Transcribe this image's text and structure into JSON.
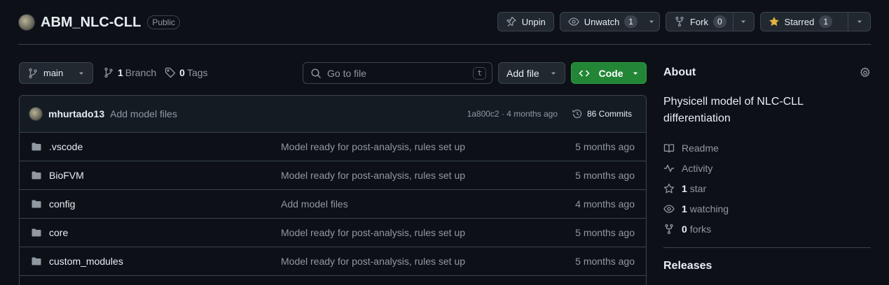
{
  "repo": {
    "name": "ABM_NLC-CLL",
    "visibility": "Public"
  },
  "actions": {
    "unpin": "Unpin",
    "unwatch": "Unwatch",
    "watch_count": "1",
    "fork": "Fork",
    "fork_count": "0",
    "starred": "Starred",
    "star_count": "1"
  },
  "toolbar": {
    "branch": "main",
    "branch_count": "1",
    "branch_label": "Branch",
    "tag_count": "0",
    "tag_label": "Tags",
    "search_placeholder": "Go to file",
    "search_shortcut": "t",
    "add_file": "Add file",
    "code": "Code"
  },
  "latest_commit": {
    "author": "mhurtado13",
    "message": "Add model files",
    "hash_time": "1a800c2 · 4 months ago",
    "commits": "86 Commits"
  },
  "files": [
    {
      "name": ".vscode",
      "message": "Model ready for post-analysis, rules set up",
      "date": "5 months ago"
    },
    {
      "name": "BioFVM",
      "message": "Model ready for post-analysis, rules set up",
      "date": "5 months ago"
    },
    {
      "name": "config",
      "message": "Add model files",
      "date": "4 months ago"
    },
    {
      "name": "core",
      "message": "Model ready for post-analysis, rules set up",
      "date": "5 months ago"
    },
    {
      "name": "custom_modules",
      "message": "Model ready for post-analysis, rules set up",
      "date": "5 months ago"
    }
  ],
  "about": {
    "title": "About",
    "description": "Physicell model of NLC-CLL differentiation",
    "readme": "Readme",
    "activity": "Activity",
    "stars_count": "1",
    "stars_label": "star",
    "watching_count": "1",
    "watching_label": "watching",
    "forks_count": "0",
    "forks_label": "forks"
  },
  "releases": {
    "title": "Releases"
  },
  "colors": {
    "background": "#0d1117",
    "border": "#3d444d",
    "code_button": "#238636",
    "star": "#e3b341",
    "muted_text": "#9198a1"
  }
}
